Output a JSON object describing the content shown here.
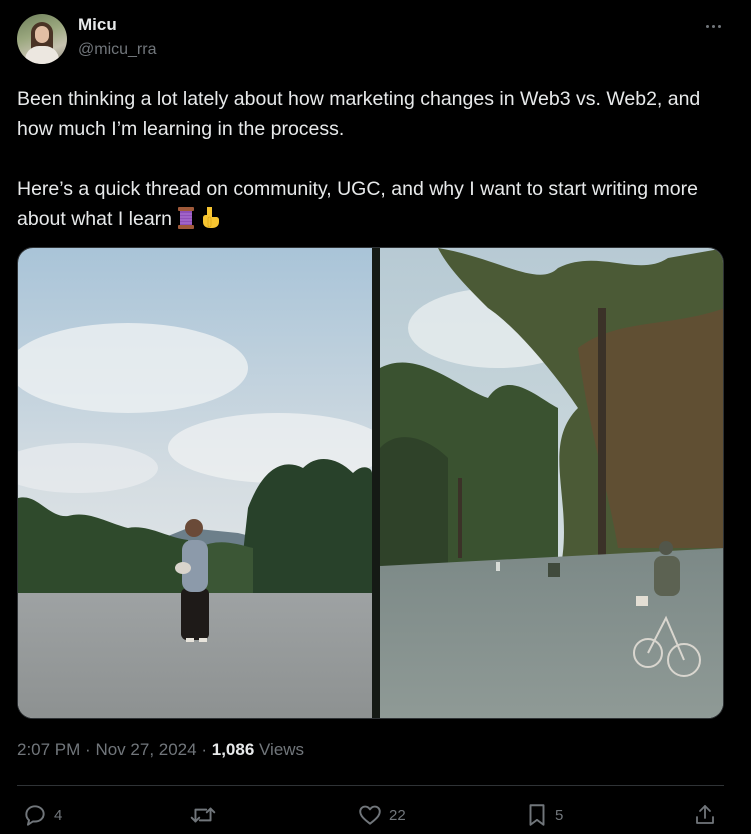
{
  "author": {
    "display_name": "Micu",
    "handle": "@micu_rra"
  },
  "tweet": {
    "paragraph_1": "Been thinking a lot lately about how marketing changes in Web3 vs. Web2, and how much I’m learning in the process.",
    "paragraph_2": "Here’s a quick thread on community, UGC, and why I want to start writing more about what I learn",
    "emojis": [
      "thread-spool-icon",
      "pointing-down-icon"
    ]
  },
  "meta": {
    "time": "2:07 PM",
    "separator": "·",
    "date": "Nov 27, 2024",
    "views_count": "1,086",
    "views_label": "Views"
  },
  "actions": {
    "replies": "4",
    "reposts": "",
    "likes": "22",
    "bookmarks": "5"
  },
  "colors": {
    "background": "#000000",
    "primary_text": "#e7e9ea",
    "secondary_text": "#71767b",
    "divider": "#2f3336"
  }
}
